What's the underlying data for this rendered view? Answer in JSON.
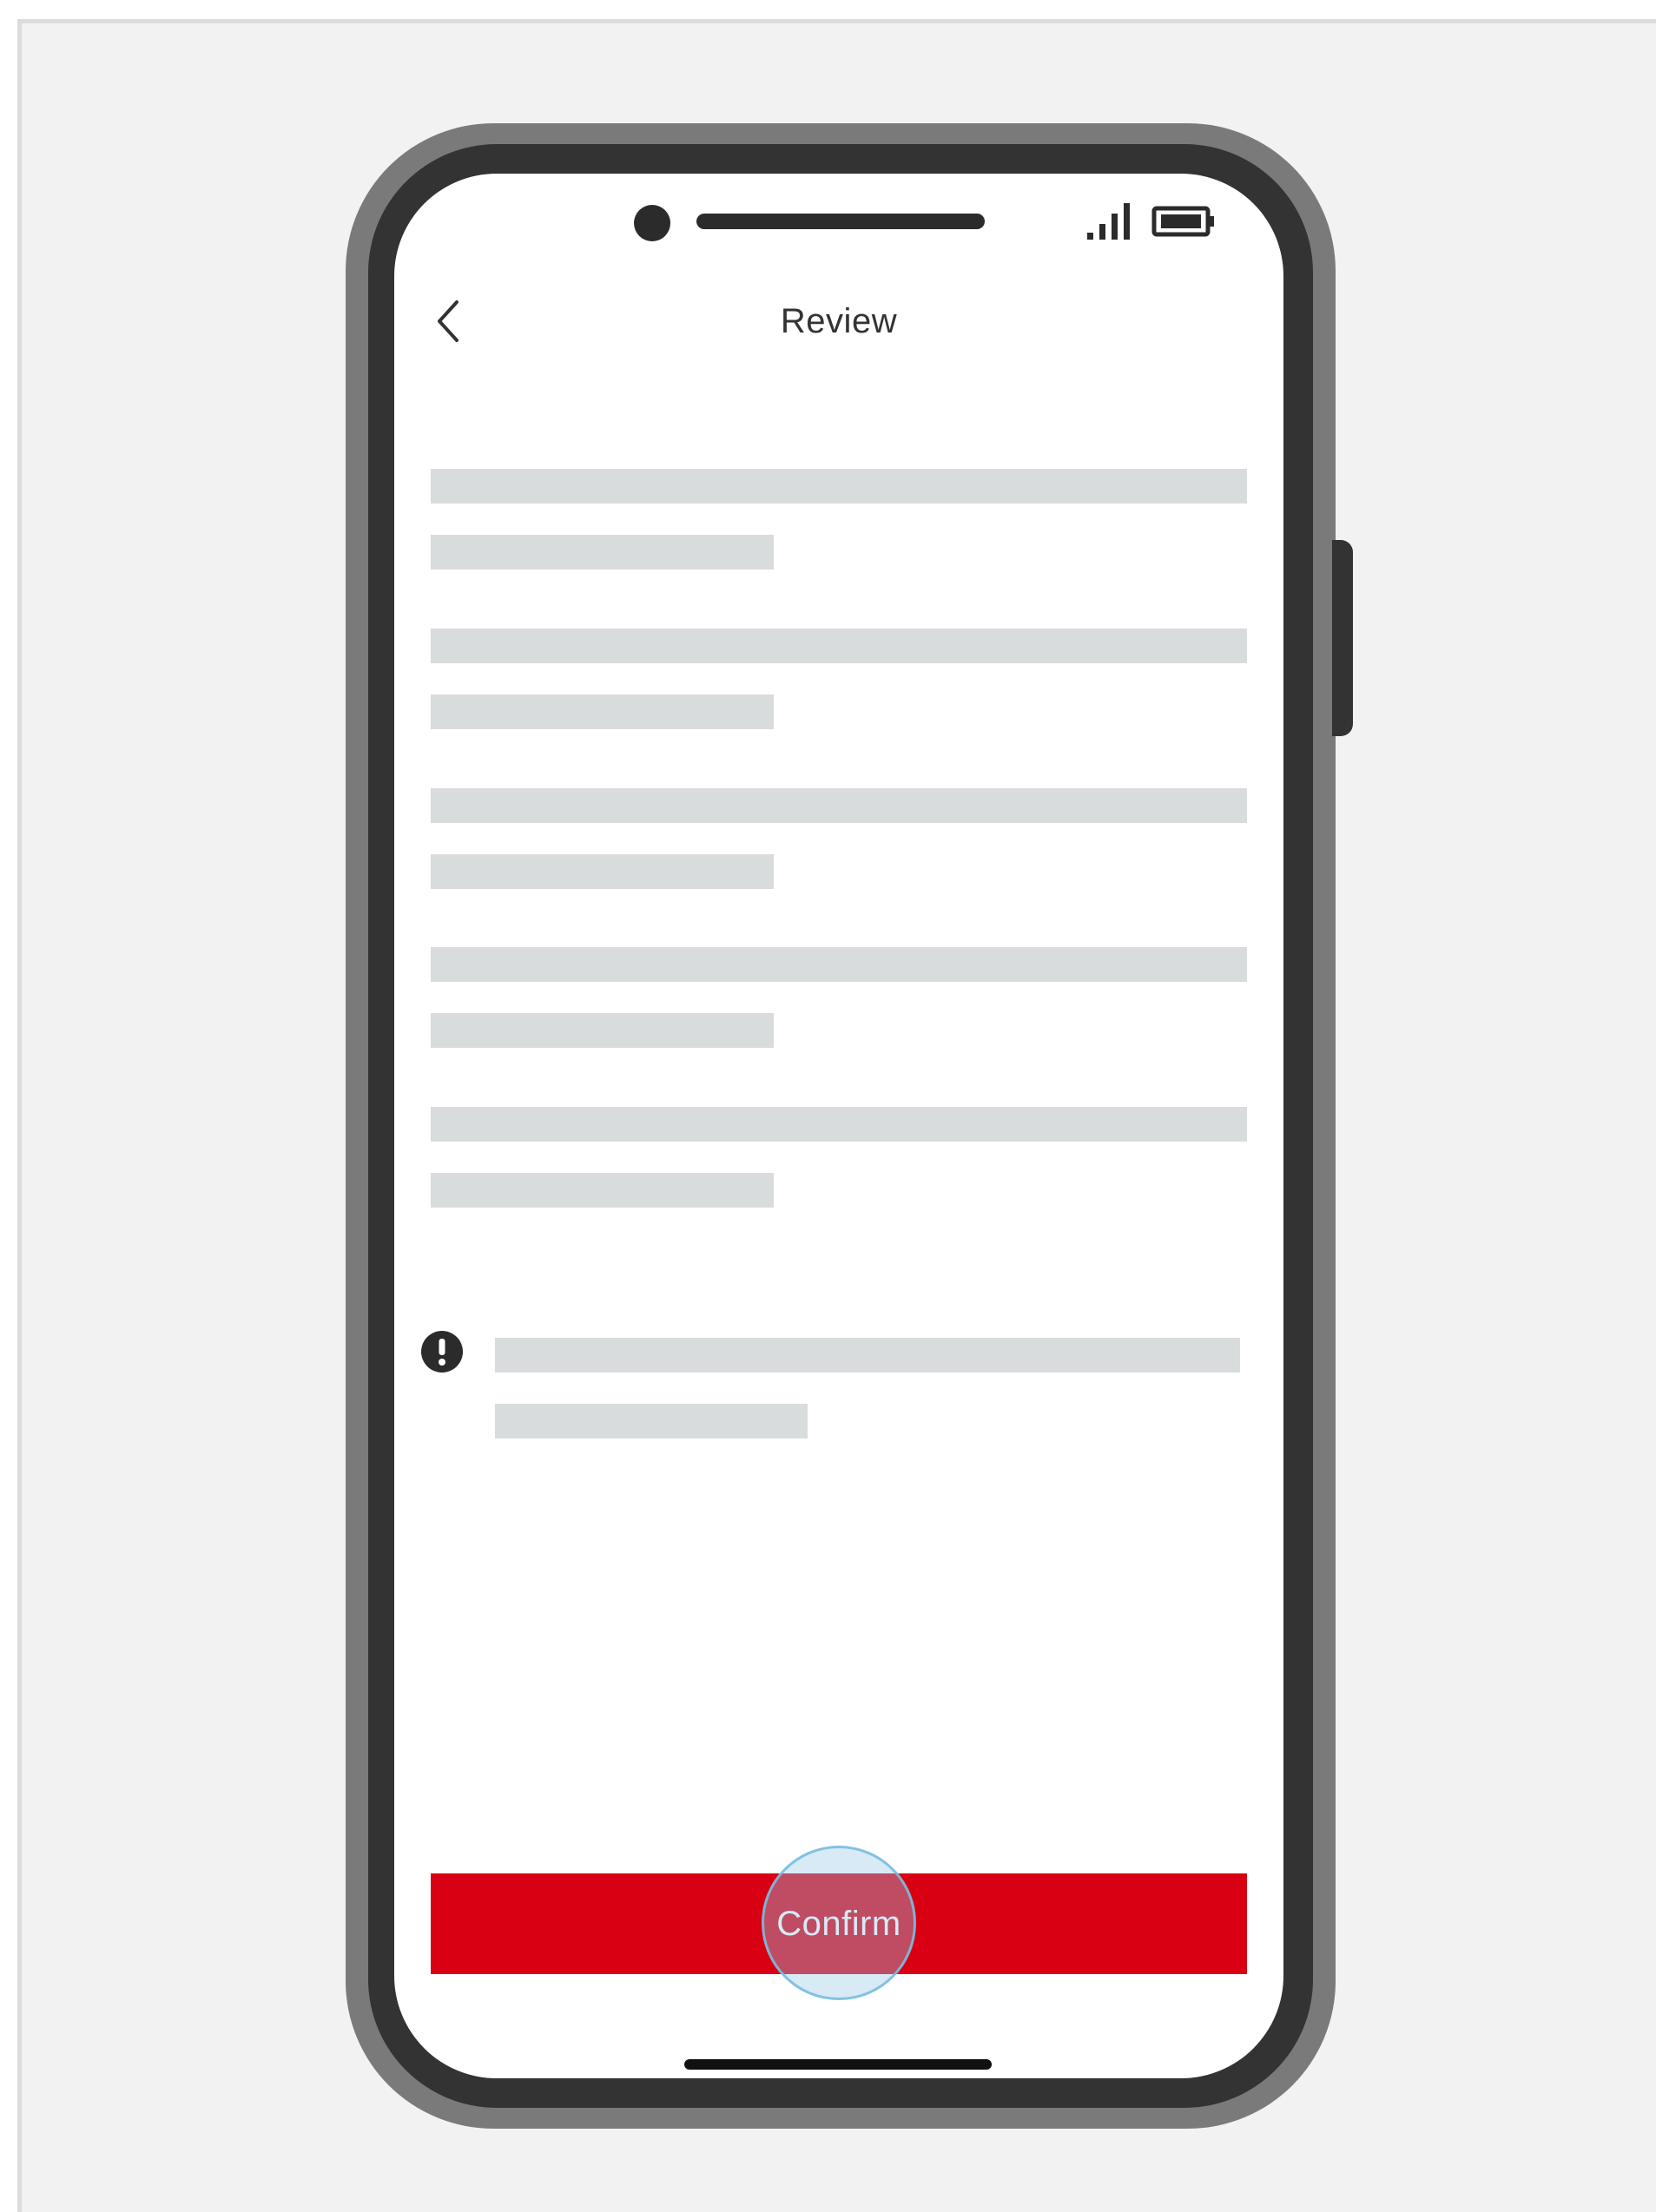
{
  "header": {
    "title": "Review",
    "back_icon": "chevron-left-icon"
  },
  "status_bar": {
    "signal_icon": "signal-bars-icon",
    "battery_icon": "battery-icon"
  },
  "notice": {
    "icon": "exclamation-circle-icon"
  },
  "actions": {
    "confirm_label": "Confirm"
  },
  "colors": {
    "primary_button": "#d80012",
    "skeleton": "#d9dcdc",
    "phone_frame": "#333333"
  }
}
